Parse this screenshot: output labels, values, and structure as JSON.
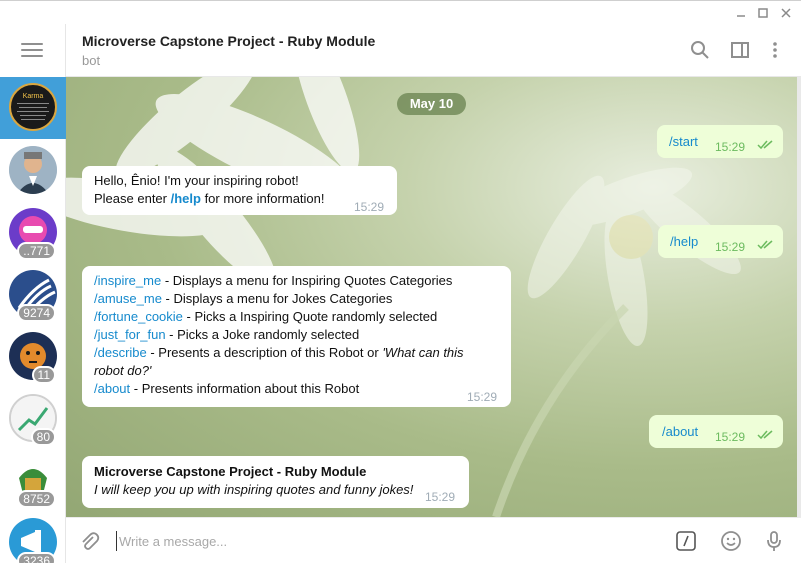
{
  "window": {
    "minimize_icon": "minimize-icon",
    "maximize_icon": "maximize-icon",
    "close_icon": "close-icon"
  },
  "sidebar": {
    "menu_icon": "hamburger-icon",
    "chats": [
      {
        "badge": "",
        "avatar": "karma-avatar",
        "active": true,
        "avatar_text": "Karma"
      },
      {
        "badge": "",
        "avatar": "man-in-suit-avatar"
      },
      {
        "badge": "..771",
        "avatar": "pink-robot-avatar"
      },
      {
        "badge": "9274",
        "avatar": "wave-logo-avatar"
      },
      {
        "badge": "11",
        "avatar": "tiger-avatar"
      },
      {
        "badge": "80",
        "avatar": "chart-logo-avatar"
      },
      {
        "badge": "8752",
        "avatar": "spartan-avatar"
      },
      {
        "badge": "3236",
        "avatar": "megaphone-avatar"
      }
    ]
  },
  "header": {
    "title": "Microverse Capstone Project - Ruby Module",
    "status": "bot",
    "icons": [
      "search-icon",
      "sidebar-toggle-icon",
      "more-vertical-icon"
    ]
  },
  "chat": {
    "date": "May 10",
    "messages": [
      {
        "dir": "out",
        "text": "/start",
        "time": "15:29"
      },
      {
        "dir": "in",
        "line1": "Hello, Ênio! I'm your inspiring robot!",
        "line2_pre": "Please enter ",
        "line2_cmd": "/help",
        "line2_post": " for more information!",
        "time": "15:29"
      },
      {
        "dir": "out",
        "text": "/help",
        "time": "15:29"
      },
      {
        "dir": "in",
        "time": "15:29",
        "items": [
          {
            "cmd": "/inspire_me",
            "desc": " - Displays a menu for Inspiring Quotes Categories"
          },
          {
            "cmd": "/amuse_me",
            "desc": " - Displays a menu for Jokes Categories"
          },
          {
            "cmd": "/fortune_cookie",
            "desc": " - Picks a Inspiring Quote randomly selected"
          },
          {
            "cmd": "/just_for_fun",
            "desc": " - Picks a Joke randomly selected"
          },
          {
            "cmd": "/describe",
            "desc": " - Presents a description of this Robot or ",
            "desc_italic": "'What can this robot do?'"
          },
          {
            "cmd": "/about",
            "desc": " - Presents information about this Robot"
          }
        ]
      },
      {
        "dir": "out",
        "text": "/about",
        "time": "15:29"
      },
      {
        "dir": "in",
        "title": "Microverse Capstone Project - Ruby Module",
        "subtitle": "I will keep you up with inspiring quotes and funny jokes!",
        "time": "15:29"
      }
    ]
  },
  "composer": {
    "placeholder": "Write a message...",
    "icons": [
      "attach-icon",
      "bot-commands-icon",
      "emoji-icon",
      "microphone-icon"
    ]
  },
  "colors": {
    "accent": "#419fd9",
    "link": "#168acd",
    "outgoing_bubble": "#eefed8",
    "check": "#6cbb5f"
  }
}
